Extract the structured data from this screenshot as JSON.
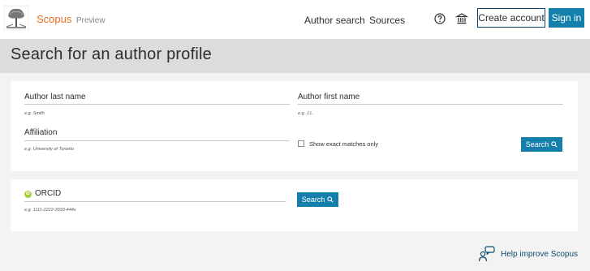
{
  "header": {
    "brand_name": "Scopus",
    "brand_suffix": "Preview",
    "nav": [
      "Author search",
      "Sources"
    ],
    "help_icon": "question-circle-icon",
    "institution_icon": "institution-icon",
    "create_account": "Create account",
    "sign_in": "Sign in"
  },
  "page": {
    "title": "Search for an author profile"
  },
  "form": {
    "last_name_label": "Author last name",
    "last_name_hint": "e.g. Smith",
    "first_name_label": "Author first name",
    "first_name_hint": "e.g. J.L.",
    "affiliation_label": "Affiliation",
    "affiliation_hint": "e.g. University of Toronto",
    "exact_matches": "Show exact matches only",
    "search_label": "Search"
  },
  "orcid": {
    "label": "ORCID",
    "hint": "e.g. 1111-2222-3333-444x",
    "search_label": "Search"
  },
  "help": {
    "label": "Help improve Scopus"
  },
  "colors": {
    "accent": "#137faa",
    "brand": "#e9711c",
    "orcid": "#a6ce39"
  }
}
